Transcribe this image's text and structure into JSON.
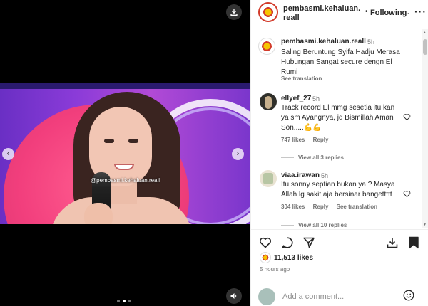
{
  "post": {
    "watermark": "@pembasmi.kehaluan.reall",
    "carousel_count": 3,
    "carousel_active": 2
  },
  "header": {
    "username": "pembasmi.kehaluan.reall",
    "dot": "•",
    "follow_label": "Following",
    "more_icon": "more-horizontal-icon"
  },
  "caption": {
    "username": "pembasmi.kehaluan.reall",
    "time": "5h",
    "text": "Saling Beruntung Syifa Hadju Merasa Hubungan Sangat secure dengn El Rumi",
    "see_translation": "See translation"
  },
  "comments": [
    {
      "username": "ellyef_27",
      "time": "5h",
      "text": "Track record El mmg sesetia itu kan ya sm Ayangnya, jd Bismillah Aman Son.....💪💪",
      "likes": "747 likes",
      "reply": "Reply",
      "view_replies": "View all 3 replies"
    },
    {
      "username": "viaa.irawan",
      "time": "5h",
      "text": "Itu sonny septian bukan ya ? Masya Allah lg sakit aja bersinar bangettttt",
      "likes": "304 likes",
      "reply": "Reply",
      "see_translation": "See translation",
      "view_replies": "View all 10 replies"
    }
  ],
  "likes": {
    "count_text": "11,513 likes"
  },
  "time_ago": "5 hours ago",
  "add_comment": {
    "placeholder": "Add a comment..."
  },
  "colors": {
    "brand_red": "#d23b2b",
    "brand_yellow": "#f6c400",
    "muted": "#737373",
    "text": "#262626"
  }
}
